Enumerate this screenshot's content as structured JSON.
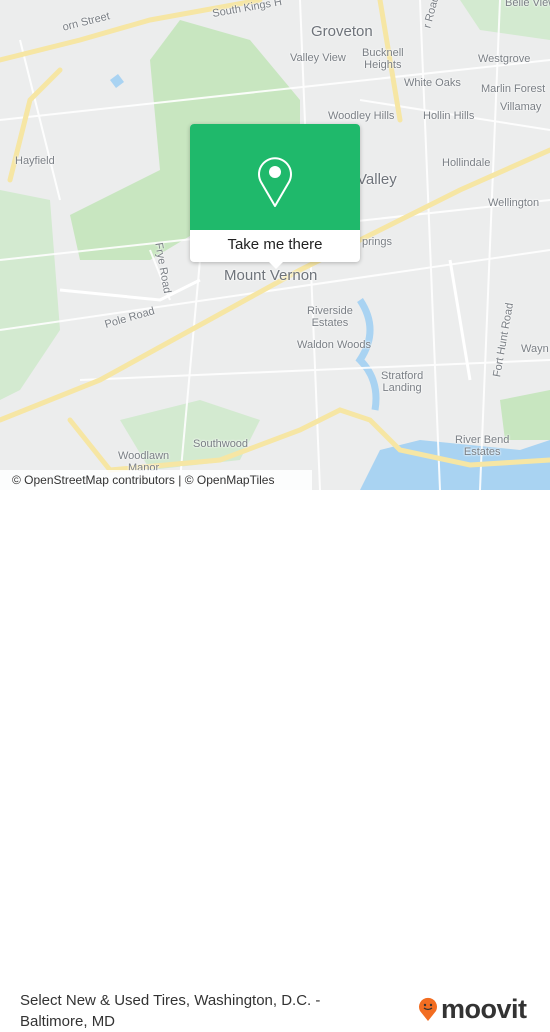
{
  "map": {
    "labels": {
      "orn_street": "orn Street",
      "south_kings": "South Kings H",
      "groveton": "Groveton",
      "r_road": "r Road",
      "belle_view": "Belle View",
      "valley_view": "Valley View",
      "bucknell_heights": "Bucknell\nHeights",
      "westgrove": "Westgrove",
      "white_oaks": "White Oaks",
      "marlin_forest": "Marlin Forest",
      "villamay": "Villamay",
      "woodley_hills": "Woodley Hills",
      "hollin_hills": "Hollin Hills",
      "hayfield": "Hayfield",
      "hollindale": "Hollindale",
      "valley": "Valley",
      "wellington": "Wellington",
      "springs": "prings",
      "frye_road": "Frye Road",
      "mount_vernon": "Mount Vernon",
      "pole_road": "Pole Road",
      "riverside_estates": "Riverside\nEstates",
      "fort_hunt_road": "Fort Hunt Road",
      "wayn": "Wayn",
      "waldon_woods": "Waldon Woods",
      "stratford_landing": "Stratford\nLanding",
      "southwood": "Southwood",
      "river_bend_estates": "River Bend\nEstates",
      "woodlawn_manor": "Woodlawn\nManor"
    },
    "attribution": "© OpenStreetMap contributors | © OpenMapTiles",
    "colors": {
      "park": "#c8e6c0",
      "water": "#a9d3f2",
      "land": "#eceded",
      "major_road": "#f6e6a4",
      "accent": "#1fb96b"
    }
  },
  "popup": {
    "icon": "map-pin-icon",
    "button_label": "Take me there"
  },
  "footer": {
    "title": "Select New & Used Tires, Washington, D.C. - Baltimore, MD",
    "logo_text": "moovit",
    "logo_color": "#f26d21"
  }
}
